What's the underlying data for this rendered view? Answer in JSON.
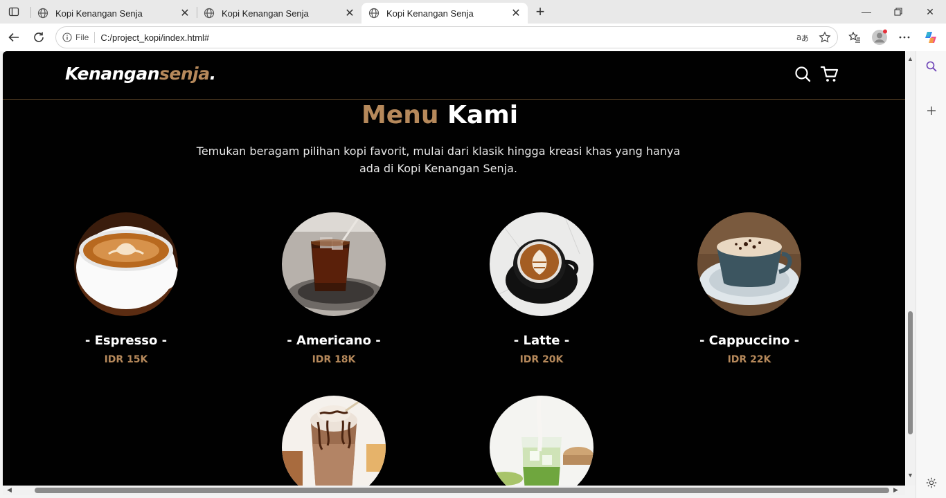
{
  "browser": {
    "tabs": [
      {
        "title": "Kopi Kenangan Senja"
      },
      {
        "title": "Kopi Kenangan Senja"
      },
      {
        "title": "Kopi Kenangan Senja"
      }
    ],
    "address": {
      "scheme_label": "File",
      "url": "C:/project_kopi/index.html#"
    }
  },
  "site": {
    "logo_main": "Kenangan",
    "logo_accent": "senja",
    "logo_dot": "."
  },
  "menu": {
    "title_accent": "Menu",
    "title_main": "Kami",
    "description": "Temukan beragam pilihan kopi favorit, mulai dari klasik hingga kreasi khas yang hanya ada di Kopi Kenangan Senja.",
    "items": [
      {
        "name": "- Espresso -",
        "price": "IDR 15K"
      },
      {
        "name": "- Americano -",
        "price": "IDR 18K"
      },
      {
        "name": "- Latte -",
        "price": "IDR 20K"
      },
      {
        "name": "- Cappuccino -",
        "price": "IDR 22K"
      },
      {
        "name": "",
        "price": ""
      },
      {
        "name": "",
        "price": ""
      }
    ]
  },
  "colors": {
    "accent": "#b6895b",
    "background": "#010101"
  }
}
